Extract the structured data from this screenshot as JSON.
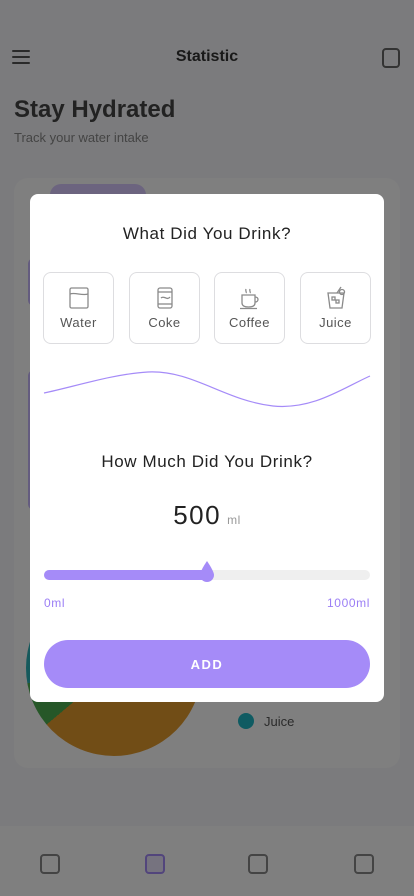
{
  "app": {
    "title": "Statistic",
    "heading": "Stay Hydrated",
    "subheading": "Track your water intake",
    "legend_label": "Juice"
  },
  "modal": {
    "title": "What Did You Drink?",
    "drinks": [
      {
        "label": "Water",
        "icon": "glass-icon"
      },
      {
        "label": "Coke",
        "icon": "can-icon"
      },
      {
        "label": "Coffee",
        "icon": "coffee-cup-icon"
      },
      {
        "label": "Juice",
        "icon": "juice-glass-icon"
      }
    ],
    "amount_title": "How Much Did You Drink?",
    "amount_value": "500",
    "amount_unit": "ml",
    "slider": {
      "min_label": "0ml",
      "max_label": "1000ml",
      "value": 500,
      "max": 1000
    },
    "add_label": "ADD"
  },
  "colors": {
    "accent": "#a58bf8",
    "overlay": "rgba(0,0,0,0.5)",
    "text": "#222222"
  }
}
